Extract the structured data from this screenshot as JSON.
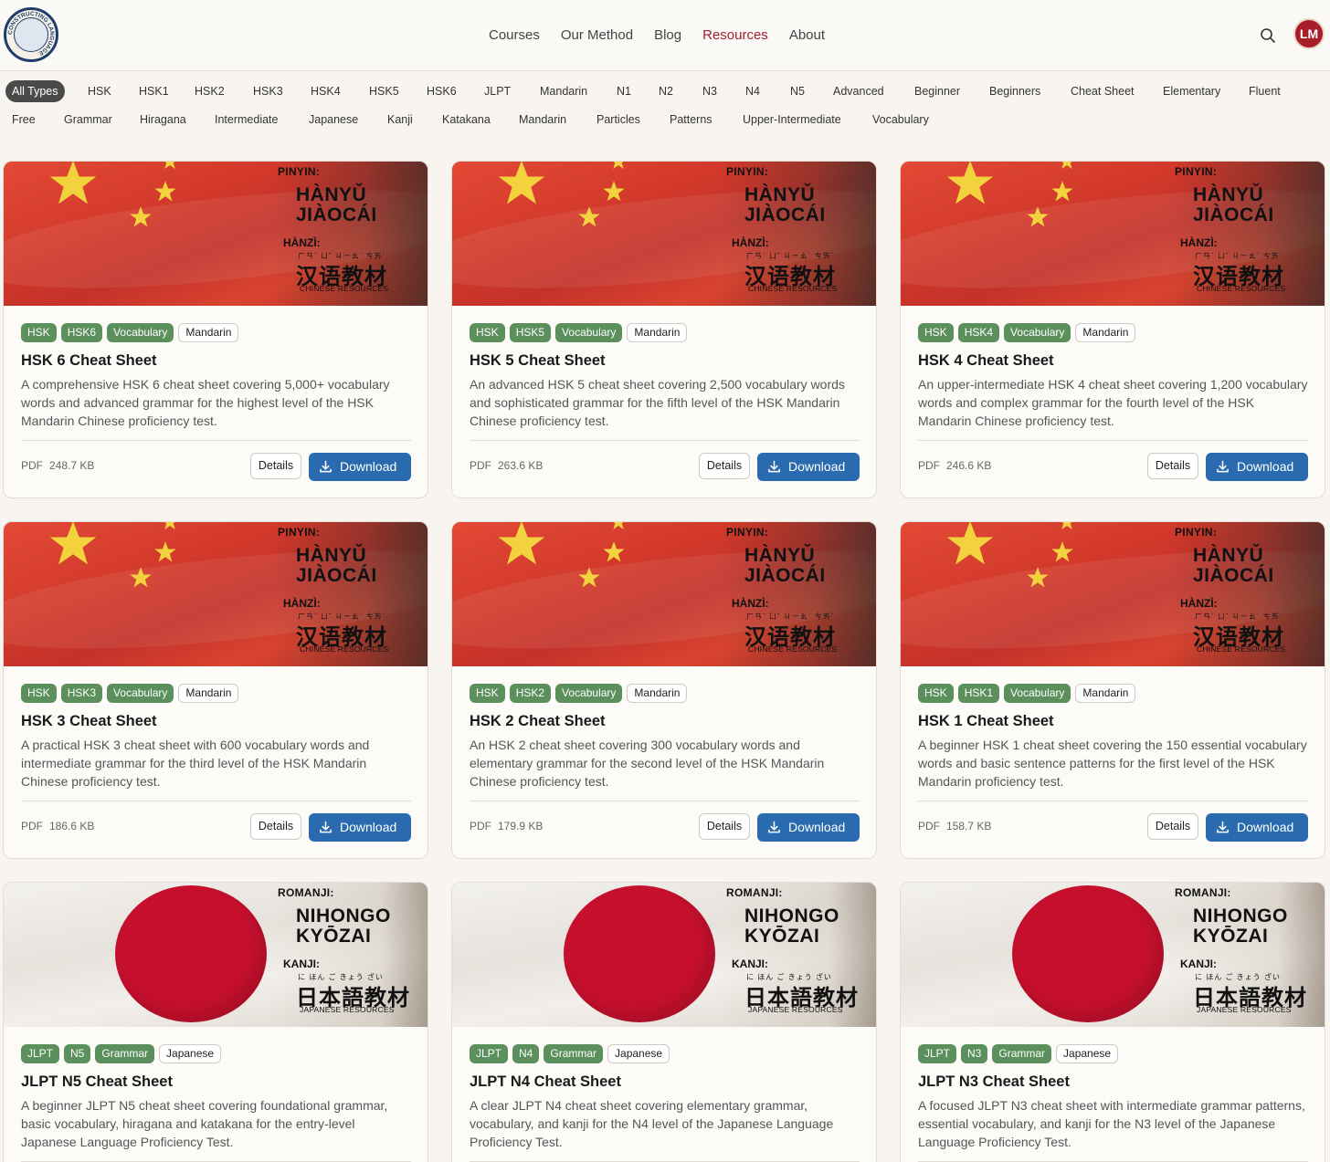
{
  "header": {
    "logo_text": "CONSTRUCTING LANGUAGE",
    "nav": [
      {
        "label": "Courses",
        "active": false
      },
      {
        "label": "Our Method",
        "active": false
      },
      {
        "label": "Blog",
        "active": false
      },
      {
        "label": "Resources",
        "active": true
      },
      {
        "label": "About",
        "active": false
      }
    ],
    "avatar_initials": "LM",
    "icons": {
      "search": "search-icon"
    },
    "colors": {
      "active_nav": "#a31e2e",
      "avatar_bg": "#a81d2a"
    }
  },
  "filters": {
    "row1": [
      "All Types",
      "HSK",
      "HSK1",
      "HSK2",
      "HSK3",
      "HSK4",
      "HSK5",
      "HSK6",
      "JLPT",
      "Mandarin",
      "N1",
      "N2",
      "N3",
      "N4",
      "N5",
      "Advanced",
      "Beginner",
      "Beginners",
      "Cheat Sheet",
      "Elementary",
      "Fluent"
    ],
    "row2": [
      "Free",
      "Grammar",
      "Hiragana",
      "Intermediate",
      "Japanese",
      "Kanji",
      "Katakana",
      "Mandarin",
      "Particles",
      "Patterns",
      "Upper-Intermediate",
      "Vocabulary"
    ],
    "active": "All Types"
  },
  "banners": {
    "cn": {
      "line1": "PINYIN:",
      "big1": "HÀNYǓ",
      "big2": "JIÀOCÁI",
      "line2": "HÀNZÌ:",
      "phonetic": "ㄏㄢˋ ㄩˇ ㄐㄧㄠˋ ㄘㄞˊ",
      "chars": "汉语教材",
      "foot": "CHINESE RESOURCES"
    },
    "jp": {
      "line1": "ROMANJI:",
      "big1": "NIHONGO",
      "big2": "KYŌZAI",
      "line2": "KANJI:",
      "phonetic": "に ほん ご きょう ざい",
      "chars": "日本語教材",
      "foot": "JAPANESE RESOURCES"
    }
  },
  "buttons": {
    "details": "Details",
    "download": "Download"
  },
  "colors": {
    "tag_green": "#5b8f5c",
    "download_blue": "#2a6bb0"
  },
  "cards": [
    {
      "banner": "cn",
      "tags": [
        "HSK",
        "HSK6",
        "Vocabulary",
        "Mandarin"
      ],
      "title": "HSK 6 Cheat Sheet",
      "desc": "A comprehensive HSK 6 cheat sheet covering 5,000+ vocabulary words and advanced grammar for the highest level of the HSK Mandarin Chinese proficiency test.",
      "format": "PDF",
      "size": "248.7 KB"
    },
    {
      "banner": "cn",
      "tags": [
        "HSK",
        "HSK5",
        "Vocabulary",
        "Mandarin"
      ],
      "title": "HSK 5 Cheat Sheet",
      "desc": "An advanced HSK 5 cheat sheet covering 2,500 vocabulary words and sophisticated grammar for the fifth level of the HSK Mandarin Chinese proficiency test.",
      "format": "PDF",
      "size": "263.6 KB"
    },
    {
      "banner": "cn",
      "tags": [
        "HSK",
        "HSK4",
        "Vocabulary",
        "Mandarin"
      ],
      "title": "HSK 4 Cheat Sheet",
      "desc": "An upper-intermediate HSK 4 cheat sheet covering 1,200 vocabulary words and complex grammar for the fourth level of the HSK Mandarin Chinese proficiency test.",
      "format": "PDF",
      "size": "246.6 KB"
    },
    {
      "banner": "cn",
      "tags": [
        "HSK",
        "HSK3",
        "Vocabulary",
        "Mandarin"
      ],
      "title": "HSK 3 Cheat Sheet",
      "desc": "A practical HSK 3 cheat sheet with 600 vocabulary words and intermediate grammar for the third level of the HSK Mandarin Chinese proficiency test.",
      "format": "PDF",
      "size": "186.6 KB"
    },
    {
      "banner": "cn",
      "tags": [
        "HSK",
        "HSK2",
        "Vocabulary",
        "Mandarin"
      ],
      "title": "HSK 2 Cheat Sheet",
      "desc": "An HSK 2 cheat sheet covering 300 vocabulary words and elementary grammar for the second level of the HSK Mandarin Chinese proficiency test.",
      "format": "PDF",
      "size": "179.9 KB"
    },
    {
      "banner": "cn",
      "tags": [
        "HSK",
        "HSK1",
        "Vocabulary",
        "Mandarin"
      ],
      "title": "HSK 1 Cheat Sheet",
      "desc": "A beginner HSK 1 cheat sheet covering the 150 essential vocabulary words and basic sentence patterns for the first level of the HSK Mandarin proficiency test.",
      "format": "PDF",
      "size": "158.7 KB"
    },
    {
      "banner": "jp",
      "tags": [
        "JLPT",
        "N5",
        "Grammar",
        "Japanese"
      ],
      "title": "JLPT N5 Cheat Sheet",
      "desc": "A beginner JLPT N5 cheat sheet covering foundational grammar, basic vocabulary, hiragana and katakana for the entry-level Japanese Language Proficiency Test.",
      "format": "",
      "size": ""
    },
    {
      "banner": "jp",
      "tags": [
        "JLPT",
        "N4",
        "Grammar",
        "Japanese"
      ],
      "title": "JLPT N4 Cheat Sheet",
      "desc": "A clear JLPT N4 cheat sheet covering elementary grammar, vocabulary, and kanji for the N4 level of the Japanese Language Proficiency Test.",
      "format": "",
      "size": ""
    },
    {
      "banner": "jp",
      "tags": [
        "JLPT",
        "N3",
        "Grammar",
        "Japanese"
      ],
      "title": "JLPT N3 Cheat Sheet",
      "desc": "A focused JLPT N3 cheat sheet with intermediate grammar patterns, essential vocabulary, and kanji for the N3 level of the Japanese Language Proficiency Test.",
      "format": "",
      "size": ""
    }
  ]
}
